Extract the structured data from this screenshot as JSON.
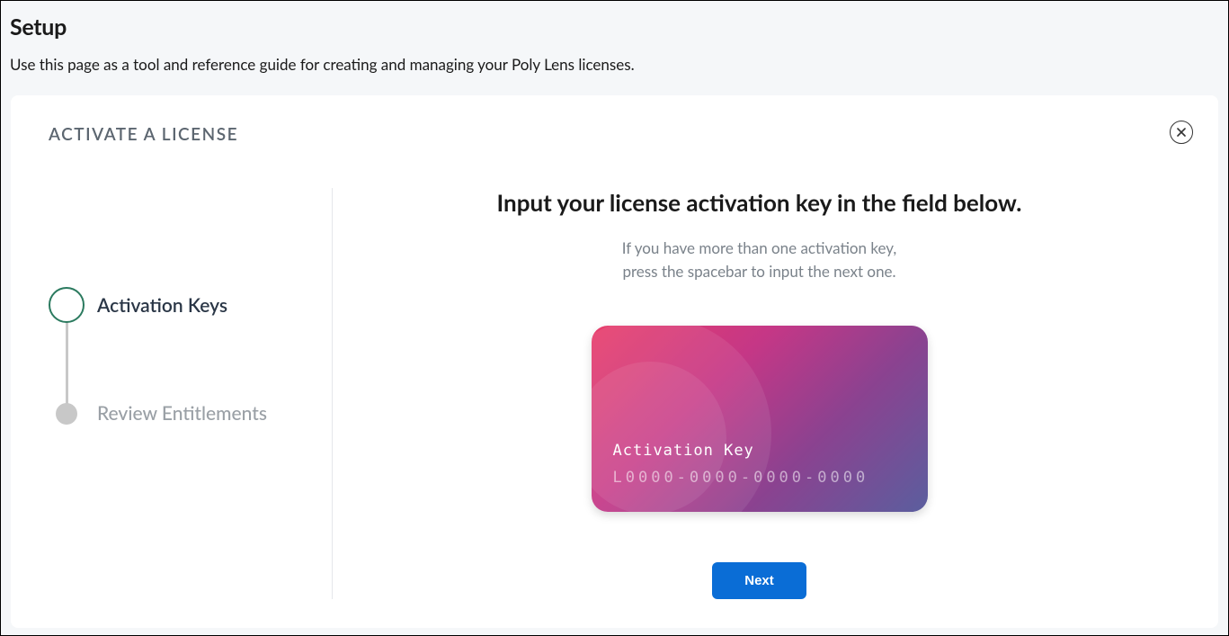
{
  "page": {
    "title": "Setup",
    "description": "Use this page as a tool and reference guide for creating and managing your Poly Lens licenses."
  },
  "card": {
    "title": "ACTIVATE A LICENSE"
  },
  "stepper": {
    "steps": [
      {
        "label": "Activation Keys",
        "state": "active"
      },
      {
        "label": "Review Entitlements",
        "state": "inactive"
      }
    ]
  },
  "main": {
    "heading": "Input your license activation key in the field below.",
    "sub_line1": "If you have more than one activation key,",
    "sub_line2": "press the spacebar to input the next one.",
    "activation": {
      "label": "Activation Key",
      "placeholder": "L0000-0000-0000-0000",
      "value": ""
    },
    "next_label": "Next"
  }
}
